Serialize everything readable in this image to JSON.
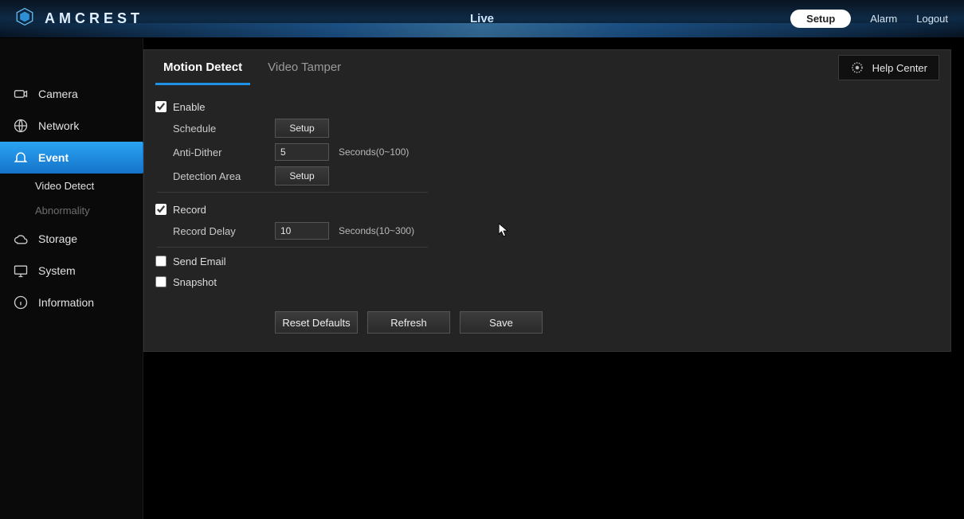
{
  "brand": "AMCREST",
  "header": {
    "center": "Live",
    "nav": {
      "setup": "Setup",
      "alarm": "Alarm",
      "logout": "Logout"
    }
  },
  "sidebar": {
    "camera": "Camera",
    "network": "Network",
    "event": "Event",
    "event_sub": {
      "video_detect": "Video Detect",
      "abnormality": "Abnormality"
    },
    "storage": "Storage",
    "system": "System",
    "information": "Information"
  },
  "tabs": {
    "motion_detect": "Motion Detect",
    "video_tamper": "Video Tamper"
  },
  "help_center": "Help Center",
  "form": {
    "enable": "Enable",
    "schedule": "Schedule",
    "setup_btn": "Setup",
    "anti_dither": "Anti-Dither",
    "anti_dither_value": "5",
    "anti_dither_hint": "Seconds(0~100)",
    "detection_area": "Detection Area",
    "record": "Record",
    "record_delay": "Record Delay",
    "record_delay_value": "10",
    "record_delay_hint": "Seconds(10~300)",
    "send_email": "Send Email",
    "snapshot": "Snapshot"
  },
  "actions": {
    "reset": "Reset Defaults",
    "refresh": "Refresh",
    "save": "Save"
  },
  "checked": {
    "enable": true,
    "record": true,
    "send_email": false,
    "snapshot": false
  }
}
